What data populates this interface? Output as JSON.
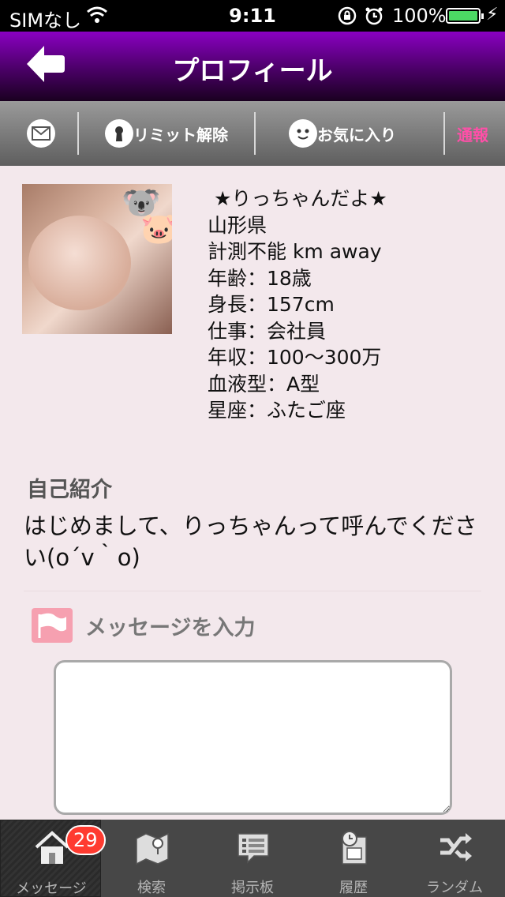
{
  "status_bar": {
    "carrier": "SIMなし",
    "time": "9:11",
    "battery_percent": "100%",
    "battery_level": 1.0
  },
  "nav": {
    "title": "プロフィール"
  },
  "toolbar": {
    "limit_label": "リミット解除",
    "favorite_label": "お気に入り",
    "report_label": "通報"
  },
  "profile": {
    "name": "★りっちゃんだよ★",
    "location": "山形県",
    "distance": "計測不能 km away",
    "age": "年齢：18歳",
    "height": "身長：157cm",
    "job": "仕事：会社員",
    "income": "年収：100～300万",
    "blood": "血液型：A型",
    "zodiac": "星座：ふたご座"
  },
  "intro": {
    "title": "自己紹介",
    "body": " はじめまして、りっちゃんって呼んでください(o´v｀o)"
  },
  "message": {
    "label": "メッセージを入力"
  },
  "tabbar": {
    "items": [
      {
        "label": "メッセージ",
        "badge": "29",
        "icon": "house-icon"
      },
      {
        "label": "検索",
        "icon": "map-icon"
      },
      {
        "label": "掲示板",
        "icon": "board-icon"
      },
      {
        "label": "履歴",
        "icon": "history-icon"
      },
      {
        "label": "ランダム",
        "icon": "shuffle-icon"
      }
    ]
  },
  "colors": {
    "nav_gradient_top": "#8a00c2",
    "background": "#f3e8ec",
    "report": "#ff4fa8",
    "badge": "#ff3b30",
    "battery": "#4cd964"
  }
}
